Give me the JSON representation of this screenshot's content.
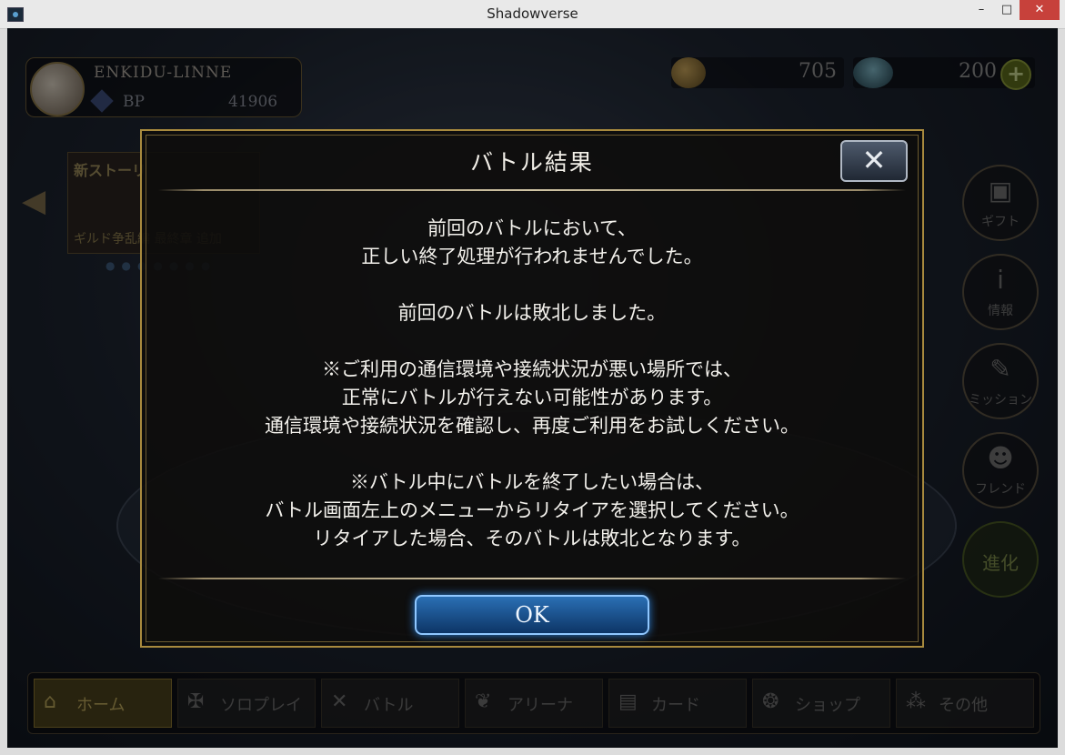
{
  "window": {
    "title": "Shadowverse",
    "buttons": {
      "minimize": "–",
      "maximize": "□",
      "close": "✕"
    }
  },
  "profile": {
    "name": "ENKIDU-LINNE",
    "bp_label": "BP",
    "bp_value": "41906"
  },
  "currency": {
    "coins": "705",
    "crystals": "200",
    "plus": "+"
  },
  "story_banner": {
    "title": "新ストーリ",
    "subtitle": "ギルド争乱編 最終章 追加"
  },
  "side_menu": {
    "gift": "ギフト",
    "info": "情報",
    "mission": "ミッション",
    "friend": "フレンド",
    "evolve": "進化"
  },
  "bottom_tabs": [
    {
      "label": "ホーム",
      "icon": "home-icon"
    },
    {
      "label": "ソロプレイ",
      "icon": "solo-icon"
    },
    {
      "label": "バトル",
      "icon": "swords-icon"
    },
    {
      "label": "アリーナ",
      "icon": "arena-icon"
    },
    {
      "label": "カード",
      "icon": "cards-icon"
    },
    {
      "label": "ショップ",
      "icon": "shop-icon"
    },
    {
      "label": "その他",
      "icon": "other-icon"
    }
  ],
  "dialog": {
    "title": "バトル結果",
    "close": "✕",
    "lines": {
      "l1": "前回のバトルにおいて、",
      "l2": "正しい終了処理が行われませんでした。",
      "l3": "前回のバトルは敗北しました。",
      "l4": "※ご利用の通信環境や接続状況が悪い場所では、",
      "l5": "正常にバトルが行えない可能性があります。",
      "l6": "通信環境や接続状況を確認し、再度ご利用をお試しください。",
      "l7": "※バトル中にバトルを終了したい場合は、",
      "l8": "バトル画面左上のメニューからリタイアを選択してください。",
      "l9": "リタイアした場合、そのバトルは敗北となります。"
    },
    "ok": "OK"
  }
}
